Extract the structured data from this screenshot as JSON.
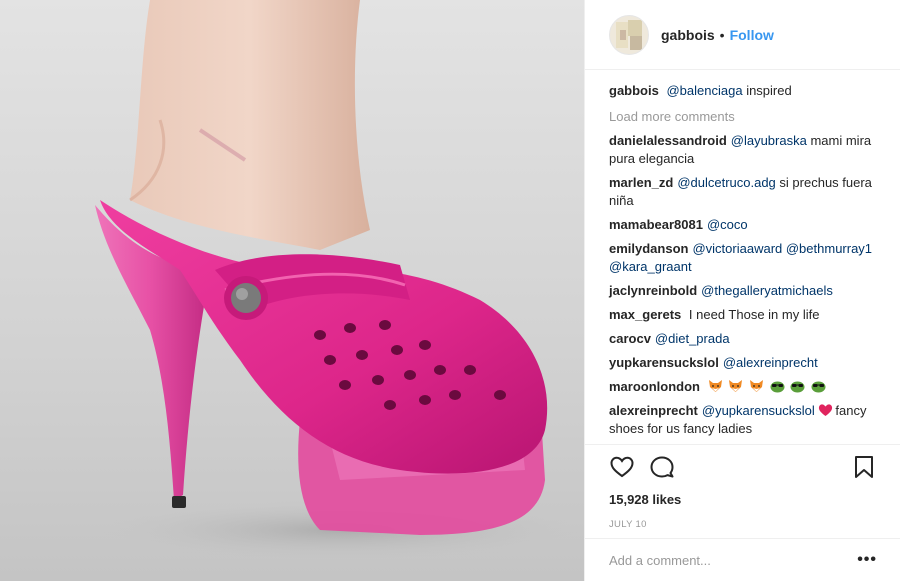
{
  "post": {
    "username": "gabbois",
    "follow_label": "Follow",
    "separator": "•",
    "caption": {
      "user": "gabbois",
      "mention": "@balenciaga",
      "text": "inspired"
    },
    "load_more": "Load more comments",
    "comments": [
      {
        "user": "danielalessandroid",
        "mention": "@layubraska",
        "text": "mami mira pura elegancia"
      },
      {
        "user": "marlen_zd",
        "mention": "@dulcetruco.adg",
        "text": "si prechus fuera niña"
      },
      {
        "user": "mamabear8081",
        "mention": "@coco",
        "text": ""
      },
      {
        "user": "emilydanson",
        "mention": "@victoriaaward @bethmurray1 @kara_graant",
        "text": ""
      },
      {
        "user": "jaclynreinbold",
        "mention": "@thegalleryatmichaels",
        "text": ""
      },
      {
        "user": "max_gerets",
        "mention": "",
        "text": "I need Those in my life"
      },
      {
        "user": "carocv",
        "mention": "@diet_prada",
        "text": ""
      },
      {
        "user": "yupkarensuckslol",
        "mention": "@alexreinprecht",
        "text": ""
      },
      {
        "user": "maroonlondon",
        "mention": "",
        "text": "",
        "emojis": [
          "fox-face",
          "fox-face",
          "fox-face",
          "sunglasses-face",
          "sunglasses-face",
          "sunglasses-face"
        ]
      },
      {
        "user": "alexreinprecht",
        "mention": "@yupkarensuckslol",
        "text": "fancy shoes for us fancy ladies",
        "emojis": [
          "heart"
        ]
      }
    ],
    "likes": "15,928 likes",
    "date": "JULY 10",
    "add_comment_placeholder": "Add a comment...",
    "more_label": "•••"
  },
  "colors": {
    "link_blue": "#3897f0",
    "mention_blue": "#003569",
    "shoe_pink": "#e0288f",
    "muted": "#999999"
  },
  "icons": [
    "heart-icon",
    "comment-icon",
    "bookmark-icon",
    "more-options-icon"
  ]
}
